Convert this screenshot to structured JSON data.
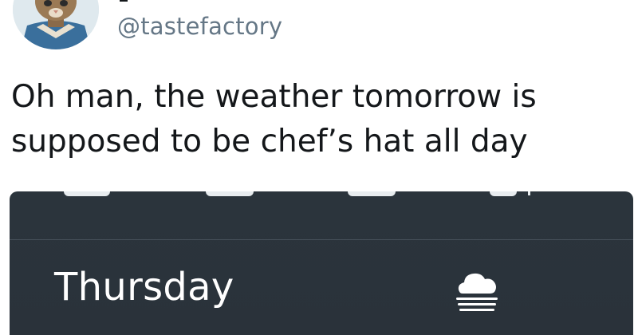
{
  "tweet": {
    "handle": "@tastefactory",
    "text_lines": [
      "Oh man, the weather tomorrow is",
      "supposed to be chef’s hat all day"
    ],
    "avatar_icon": "cat-avatar-icon"
  },
  "weather": {
    "day": "Thursday",
    "condition_icon": "cloud-fog-icon",
    "colors": {
      "card_background": "#2b343c",
      "divider": "#46505a",
      "text": "#ffffff"
    }
  }
}
